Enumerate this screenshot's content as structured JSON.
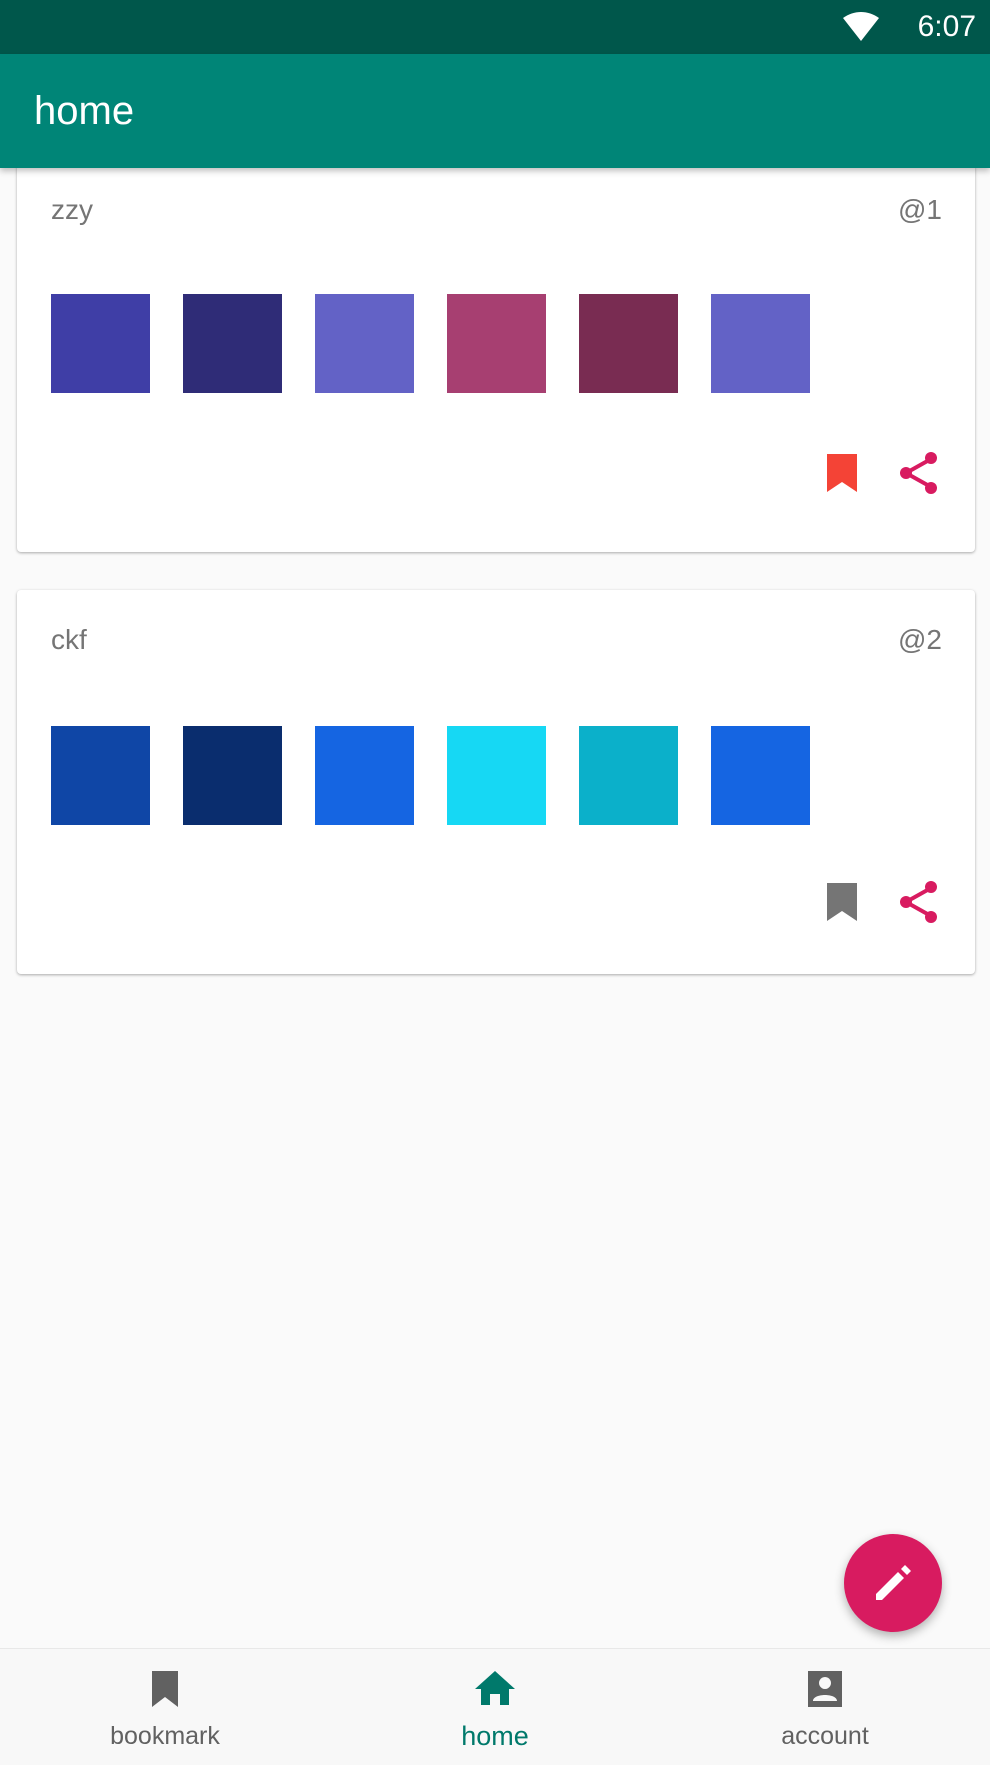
{
  "status_bar": {
    "time": "6:07",
    "wifi_icon": "wifi-icon"
  },
  "app_bar": {
    "title": "home"
  },
  "cards": [
    {
      "name": "zzy",
      "id": "@1",
      "colors": [
        "#3f3ea6",
        "#2f2c77",
        "#6362c6",
        "#a73f71",
        "#792c52",
        "#6362c6"
      ],
      "bookmarked": true,
      "bookmark_color": "#f44336",
      "share_color": "#d81b60"
    },
    {
      "name": "ckf",
      "id": "@2",
      "colors": [
        "#0f46a6",
        "#0a2d6e",
        "#1565e2",
        "#16d8f4",
        "#0bb0ca",
        "#1565e2"
      ],
      "bookmarked": false,
      "bookmark_color": "#757575",
      "share_color": "#d81b60"
    }
  ],
  "bottom_nav": {
    "items": [
      {
        "label": "bookmark",
        "icon": "bookmark-icon",
        "active": false
      },
      {
        "label": "home",
        "icon": "home-icon",
        "active": true
      },
      {
        "label": "account",
        "icon": "account-box-icon",
        "active": false
      }
    ],
    "active_color": "#00796b",
    "inactive_color": "#616161"
  },
  "fab": {
    "icon": "edit-pencil-icon",
    "color": "#d81b60"
  }
}
